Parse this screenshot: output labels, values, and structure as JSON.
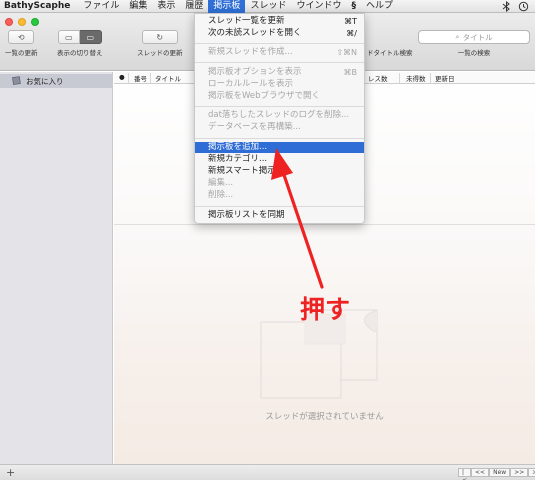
{
  "menubar": {
    "app_name": "BathyScaphe",
    "items": [
      "ファイル",
      "編集",
      "表示",
      "履歴",
      "掲示板",
      "スレッド",
      "ウインドウ",
      "ヘルプ"
    ],
    "active_item": "掲示板"
  },
  "toolbar": {
    "refresh_list_label": "一覧の更新",
    "toggle_view_label": "表示の切り替え",
    "refresh_thread_label": "スレッドの更新",
    "search_label": "一覧の検索",
    "search_placeholder": "タイトル",
    "thread_title_search_fragment": "ドタイトル検索"
  },
  "sidebar": {
    "items": [
      {
        "label": "お気に入り",
        "icon": "board-icon",
        "selected": true
      }
    ]
  },
  "thread_list": {
    "columns": [
      "●",
      "番号",
      "タイトル",
      "レス数",
      "未得数",
      "更新日"
    ]
  },
  "empty_state": {
    "message": "スレッドが選択されていません",
    "icon": "document-placeholder-icon"
  },
  "statusbar": {
    "add_label": "+",
    "pager": [
      "|<",
      "<<",
      "New",
      ">>",
      ">|"
    ]
  },
  "dropdown": {
    "items": [
      {
        "label": "スレッド一覧を更新",
        "shortcut": "⌘T",
        "disabled": false
      },
      {
        "label": "次の未読スレッドを開く",
        "shortcut": "⌘/",
        "disabled": false
      },
      {
        "label": "新規スレッドを作成...",
        "shortcut": "⇧⌘N",
        "disabled": true
      },
      {
        "label": "掲示板オプションを表示",
        "shortcut": "⌘B",
        "disabled": true
      },
      {
        "label": "ローカルルールを表示",
        "shortcut": "",
        "disabled": true
      },
      {
        "label": "掲示板をWebブラウザで開く",
        "shortcut": "",
        "disabled": true
      },
      {
        "label": "dat落ちしたスレッドのログを削除...",
        "shortcut": "",
        "disabled": true
      },
      {
        "label": "データベースを再構築...",
        "shortcut": "",
        "disabled": true
      },
      {
        "label": "掲示板を追加...",
        "shortcut": "",
        "disabled": false,
        "selected": true
      },
      {
        "label": "新規カテゴリ...",
        "shortcut": "",
        "disabled": false
      },
      {
        "label": "新規スマート掲示板...",
        "shortcut": "",
        "disabled": false
      },
      {
        "label": "編集...",
        "shortcut": "",
        "disabled": true
      },
      {
        "label": "削除...",
        "shortcut": "",
        "disabled": true
      },
      {
        "label": "掲示板リストを同期",
        "shortcut": "",
        "disabled": false
      }
    ]
  },
  "annotation": {
    "text": "押す",
    "color": "#ef2222"
  },
  "colors": {
    "menu_highlight": "#2e6cd6",
    "sidebar_selected": "#c7c9d3",
    "traffic_close": "#fc5f57",
    "traffic_min": "#fdbc2e",
    "traffic_max": "#28c840"
  }
}
